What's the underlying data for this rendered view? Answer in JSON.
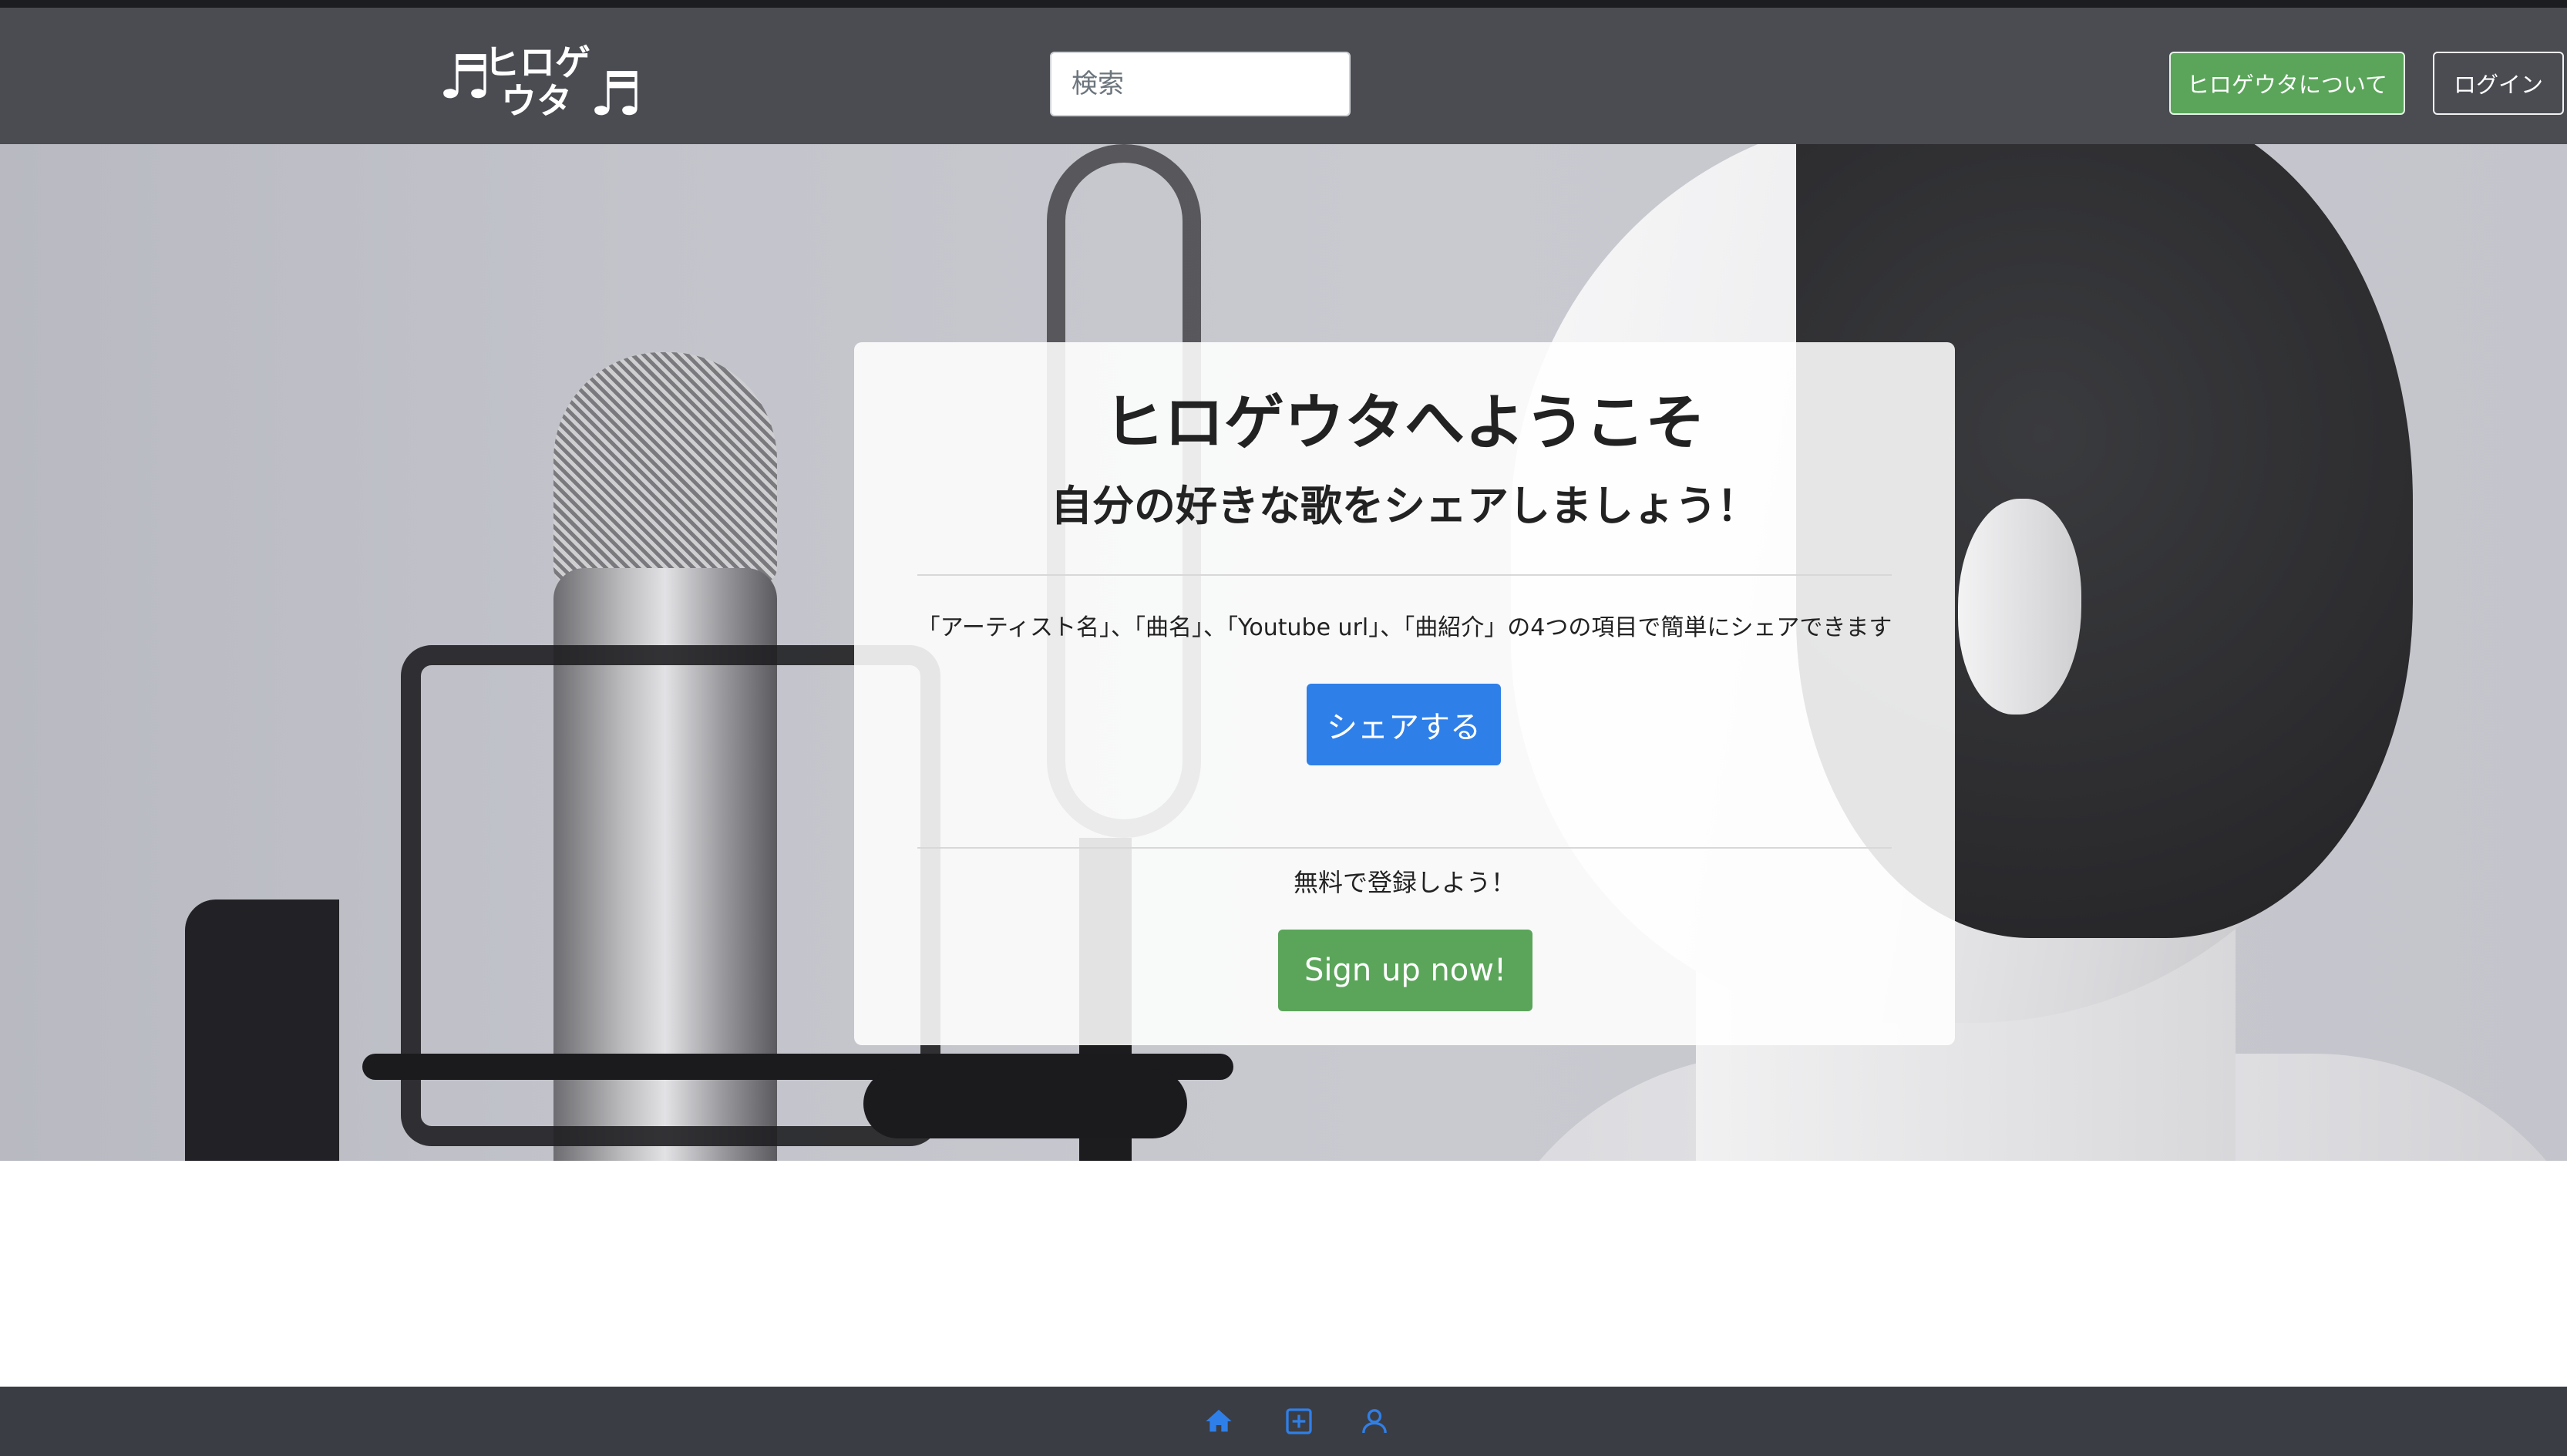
{
  "header": {
    "logo_line1": "ヒロゲ",
    "logo_line2": "ウタ",
    "logo_note_left": "♬",
    "logo_note_right": "♬",
    "search_placeholder": "検索",
    "about_label": "ヒロゲウタについて",
    "login_label": "ログイン"
  },
  "hero": {
    "title": "ヒロゲウタへようこそ",
    "subtitle": "自分の好きな歌をシェアしましょう！",
    "description": "「アーティスト名」、「曲名」、「Youtube url」、「曲紹介」の4つの項目で簡単にシェアできます",
    "share_button": "シェアする",
    "free_text": "無料で登録しよう！",
    "signup_button": "Sign up now!"
  },
  "footer": {
    "icons": [
      "home-icon",
      "add-icon",
      "user-icon"
    ]
  },
  "colors": {
    "navbar": "#4a4c52",
    "footer": "#3b3d44",
    "primary": "#2f7fe8",
    "success": "#5aa55a"
  }
}
